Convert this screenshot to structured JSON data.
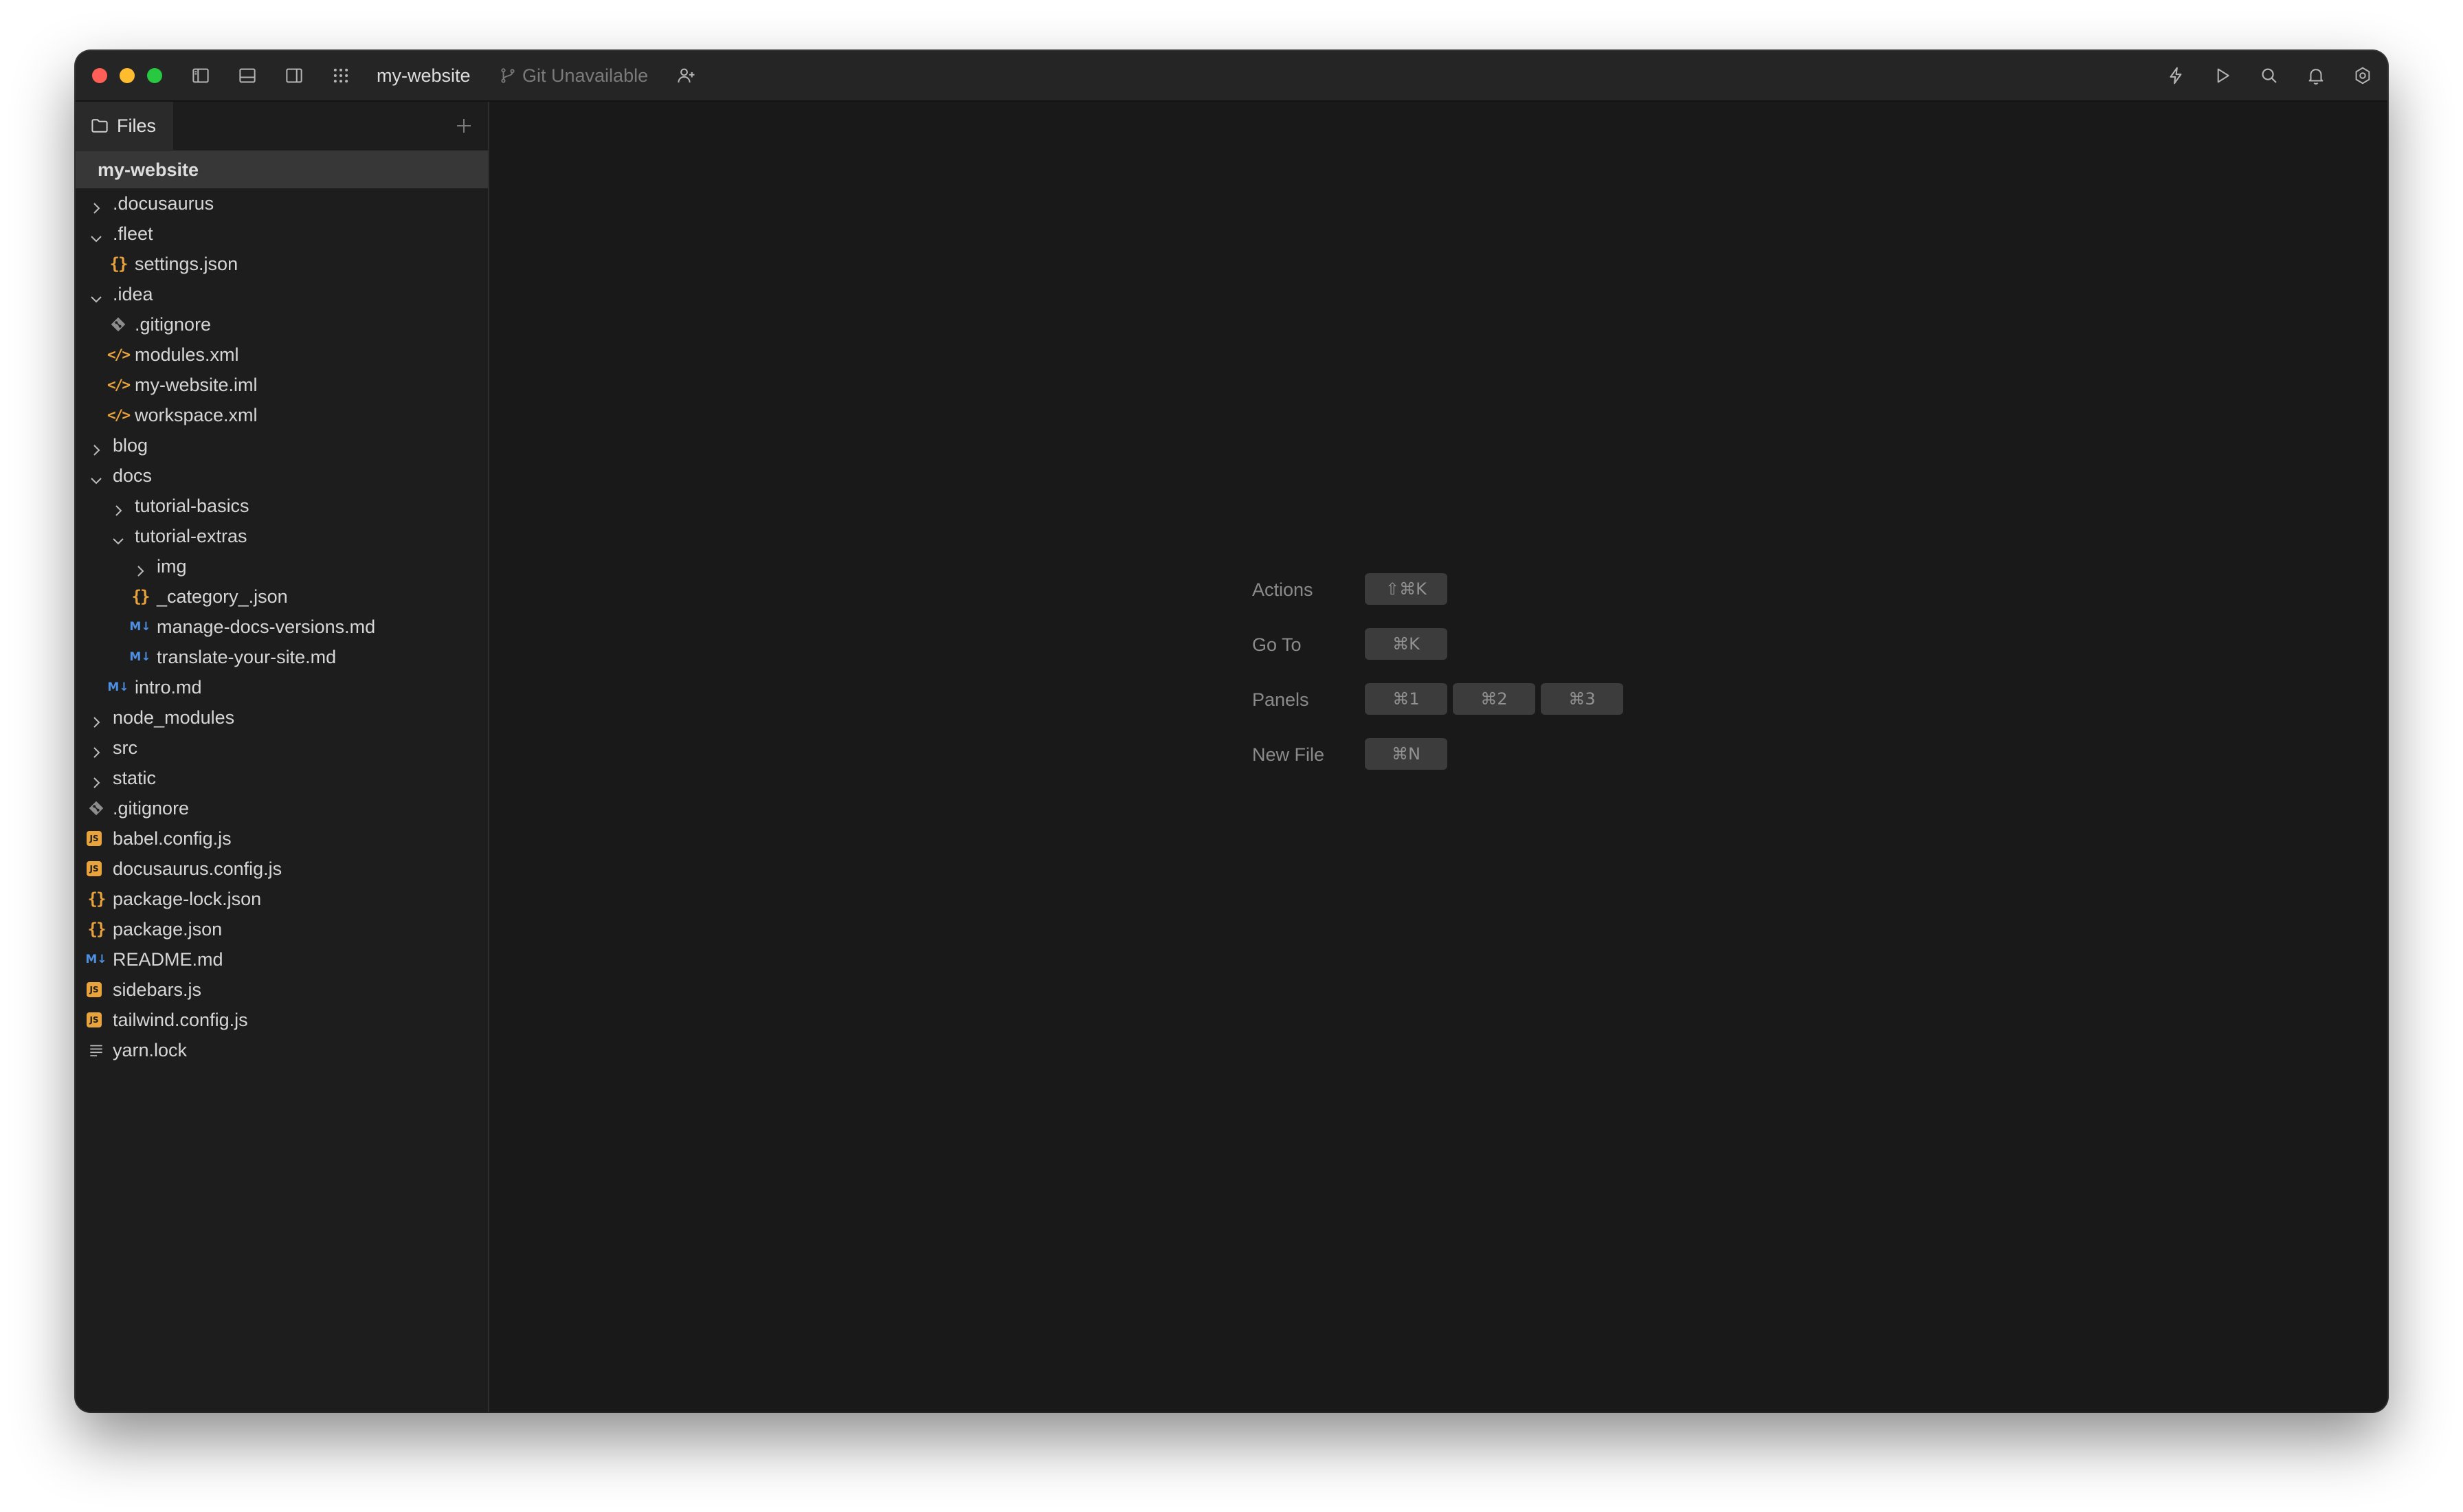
{
  "titlebar": {
    "project_name": "my-website",
    "git_status": "Git Unavailable"
  },
  "sidebar": {
    "tab_label": "Files",
    "project_header": "my-website",
    "tree": [
      {
        "name": ".docusaurus",
        "type": "folder",
        "depth": 0,
        "expanded": false
      },
      {
        "name": ".fleet",
        "type": "folder",
        "depth": 0,
        "expanded": true
      },
      {
        "name": "settings.json",
        "type": "json",
        "depth": 1
      },
      {
        "name": ".idea",
        "type": "folder",
        "depth": 0,
        "expanded": true
      },
      {
        "name": ".gitignore",
        "type": "git",
        "depth": 1
      },
      {
        "name": "modules.xml",
        "type": "xml",
        "depth": 1
      },
      {
        "name": "my-website.iml",
        "type": "xml",
        "depth": 1
      },
      {
        "name": "workspace.xml",
        "type": "xml",
        "depth": 1
      },
      {
        "name": "blog",
        "type": "folder",
        "depth": 0,
        "expanded": false
      },
      {
        "name": "docs",
        "type": "folder",
        "depth": 0,
        "expanded": true
      },
      {
        "name": "tutorial-basics",
        "type": "folder",
        "depth": 1,
        "expanded": false
      },
      {
        "name": "tutorial-extras",
        "type": "folder",
        "depth": 1,
        "expanded": true
      },
      {
        "name": "img",
        "type": "folder",
        "depth": 2,
        "expanded": false
      },
      {
        "name": "_category_.json",
        "type": "json",
        "depth": 2
      },
      {
        "name": "manage-docs-versions.md",
        "type": "md",
        "depth": 2
      },
      {
        "name": "translate-your-site.md",
        "type": "md",
        "depth": 2
      },
      {
        "name": "intro.md",
        "type": "md",
        "depth": 1
      },
      {
        "name": "node_modules",
        "type": "folder",
        "depth": 0,
        "expanded": false
      },
      {
        "name": "src",
        "type": "folder",
        "depth": 0,
        "expanded": false
      },
      {
        "name": "static",
        "type": "folder",
        "depth": 0,
        "expanded": false
      },
      {
        "name": ".gitignore",
        "type": "git",
        "depth": 0
      },
      {
        "name": "babel.config.js",
        "type": "js",
        "depth": 0
      },
      {
        "name": "docusaurus.config.js",
        "type": "js",
        "depth": 0
      },
      {
        "name": "package-lock.json",
        "type": "json",
        "depth": 0
      },
      {
        "name": "package.json",
        "type": "json",
        "depth": 0
      },
      {
        "name": "README.md",
        "type": "md",
        "depth": 0
      },
      {
        "name": "sidebars.js",
        "type": "js",
        "depth": 0
      },
      {
        "name": "tailwind.config.js",
        "type": "js",
        "depth": 0
      },
      {
        "name": "yarn.lock",
        "type": "text",
        "depth": 0
      }
    ]
  },
  "icons": {
    "json": "{}",
    "xml": "</>",
    "md": "M↓",
    "js": "JS"
  },
  "shortcuts": [
    {
      "label": "Actions",
      "keys": [
        "⇧⌘K"
      ]
    },
    {
      "label": "Go To",
      "keys": [
        "⌘K"
      ]
    },
    {
      "label": "Panels",
      "keys": [
        "⌘1",
        "⌘2",
        "⌘3"
      ]
    },
    {
      "label": "New File",
      "keys": [
        "⌘N"
      ]
    }
  ],
  "colors": {
    "accent_json": "#e8a33c",
    "accent_md": "#4d8fe3",
    "background": "#191919",
    "sidebar": "#1d1d1d"
  }
}
